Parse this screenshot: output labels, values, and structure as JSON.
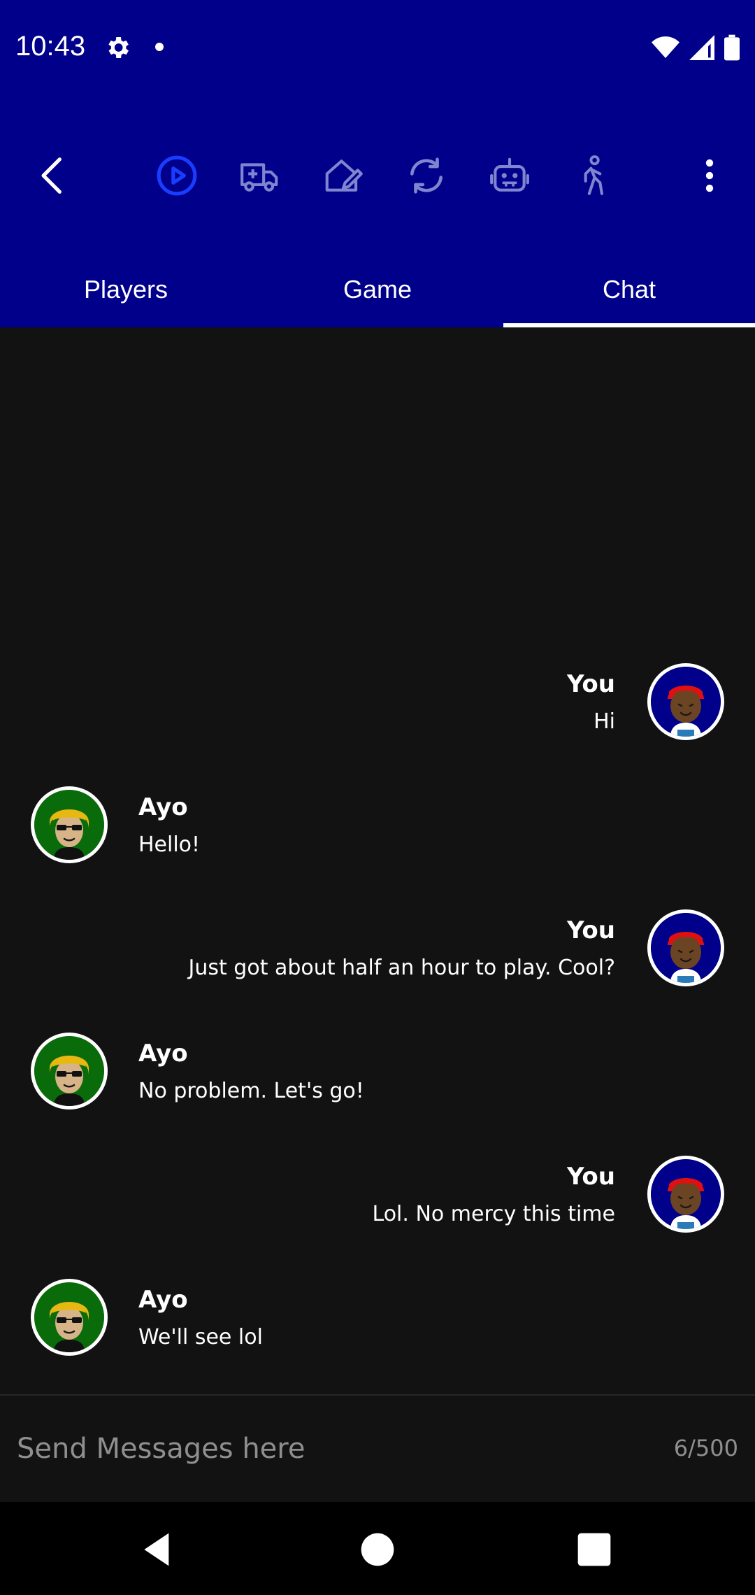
{
  "status": {
    "time": "10:43",
    "icons": [
      "settings-gear-icon",
      "notification-dot-icon",
      "wifi-icon",
      "cell-signal-icon",
      "battery-icon"
    ]
  },
  "toolbar": {
    "icons": [
      "back-arrow-icon",
      "play-circle-icon",
      "ambulance-icon",
      "edit-home-icon",
      "refresh-icon",
      "robot-icon",
      "walking-person-icon",
      "more-vert-icon"
    ],
    "accent_color": "#1a3cff"
  },
  "tabs": [
    {
      "label": "Players"
    },
    {
      "label": "Game"
    },
    {
      "label": "Chat"
    }
  ],
  "selected_tab": "Chat",
  "messages": [
    {
      "sender": "You",
      "text": "Hi",
      "side": "right"
    },
    {
      "sender": "Ayo",
      "text": "Hello!",
      "side": "left"
    },
    {
      "sender": "You",
      "text": "Just got about half an hour to play. Cool?",
      "side": "right"
    },
    {
      "sender": "Ayo",
      "text": "No problem. Let's go!",
      "side": "left"
    },
    {
      "sender": "You",
      "text": "Lol. No mercy this time",
      "side": "right"
    },
    {
      "sender": "Ayo",
      "text": "We'll see lol",
      "side": "left"
    }
  ],
  "input": {
    "placeholder": "Send Messages here",
    "value": "",
    "counter": "6/500"
  },
  "colors": {
    "header_bg": "#00008a",
    "chat_bg": "#121212",
    "you_avatar_bg": "#00008a",
    "ayo_avatar_bg": "#0a6b0a"
  }
}
